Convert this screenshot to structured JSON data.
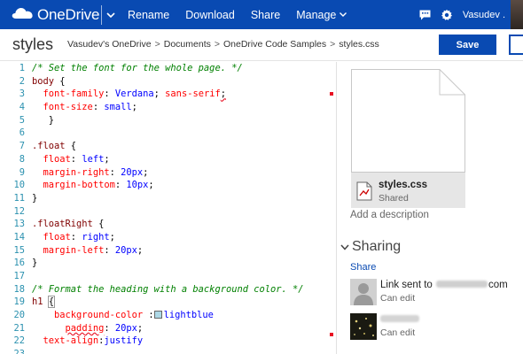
{
  "topbar": {
    "brand": "OneDrive",
    "commands": [
      "Rename",
      "Download",
      "Share",
      "Manage"
    ],
    "user": "Vasudev .",
    "bg_color": "#094ab2"
  },
  "header": {
    "title": "styles",
    "breadcrumb": [
      "Vasudev's OneDrive",
      "Documents",
      "OneDrive Code Samples",
      "styles.css"
    ],
    "breadcrumb_separator": ">",
    "save_label": "Save"
  },
  "editor": {
    "line_numbers": [
      "1",
      "2",
      "3",
      "4",
      "5",
      "6",
      "7",
      "8",
      "9",
      "10",
      "11",
      "12",
      "13",
      "14",
      "15",
      "16",
      "17",
      "18",
      "19",
      "20",
      "21",
      "22",
      "23"
    ],
    "lines": {
      "l1": "/* Set the font for the whole page. */",
      "l2_sel": "body",
      "l2_brace": " {",
      "l3_prop": "font-family",
      "l3_colon": ": ",
      "l3_val1": "Verdana",
      "l3_sep": "; ",
      "l3_val2": "sans-serif",
      "l3_end": ";",
      "l4_prop": "font-size",
      "l4_colon": ": ",
      "l4_val": "small",
      "l4_end": ";",
      "l5": "}",
      "l7_sel": ".float",
      "l7_brace": " {",
      "l8_prop": "float",
      "l8_colon": ": ",
      "l8_val": "left",
      "l8_end": ";",
      "l9_prop": "margin-right",
      "l9_colon": ": ",
      "l9_val": "20px",
      "l9_end": ";",
      "l10_prop": "margin-bottom",
      "l10_colon": ": ",
      "l10_val": "10px",
      "l10_end": ";",
      "l11": "}",
      "l13_sel": ".floatRight",
      "l13_brace": " {",
      "l14_prop": "float",
      "l14_colon": ": ",
      "l14_val": "right",
      "l14_end": ";",
      "l15_prop": "margin-left",
      "l15_colon": ": ",
      "l15_val": "20px",
      "l15_end": ";",
      "l16": "}",
      "l18": "/* Format the heading with a background color. */",
      "l19_sel": "h1",
      "l19_brace": "{",
      "l20_prop": "background-color",
      "l20_colon": " :",
      "l20_val": "lightblue",
      "l21_prop": "padding",
      "l21_colon": ": ",
      "l21_val": "20px",
      "l21_end": ";",
      "l22_prop": "text-align",
      "l22_colon": ":",
      "l22_val": "justify"
    }
  },
  "details": {
    "file_name": "styles.css",
    "file_status": "Shared",
    "add_description": "Add a description",
    "sharing_title": "Sharing",
    "share_link": "Share",
    "entries": [
      {
        "prefix": "Link sent to ",
        "suffix": "com",
        "permission": "Can edit"
      },
      {
        "permission": "Can edit"
      }
    ]
  }
}
